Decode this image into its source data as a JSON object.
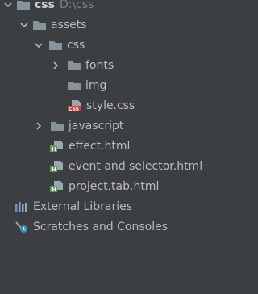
{
  "tree": {
    "root": {
      "name": "css",
      "path": "D:\\css"
    },
    "assets": "assets",
    "css_folder": "css",
    "fonts": "fonts",
    "img": "img",
    "style_css": "style.css",
    "javascript": "javascript",
    "effect_html": "effect.html",
    "event_html": "event and selector.html",
    "project_html": "project.tab.html",
    "external_libraries": "External Libraries",
    "scratches": "Scratches and Consoles"
  },
  "icons": {
    "expanded": "chevron-down-icon",
    "collapsed": "chevron-right-icon",
    "folder": "folder-icon",
    "css_file": "css-file-icon",
    "html_file": "html-file-icon",
    "libraries": "external-libraries-icon",
    "scratches": "scratches-icon"
  },
  "colors": {
    "background": "#3c3f41",
    "text": "#bbbbbb",
    "muted_text": "#808080",
    "folder": "#87939a",
    "css_badge": "#c14545",
    "html_badge": "#5aa05a"
  }
}
